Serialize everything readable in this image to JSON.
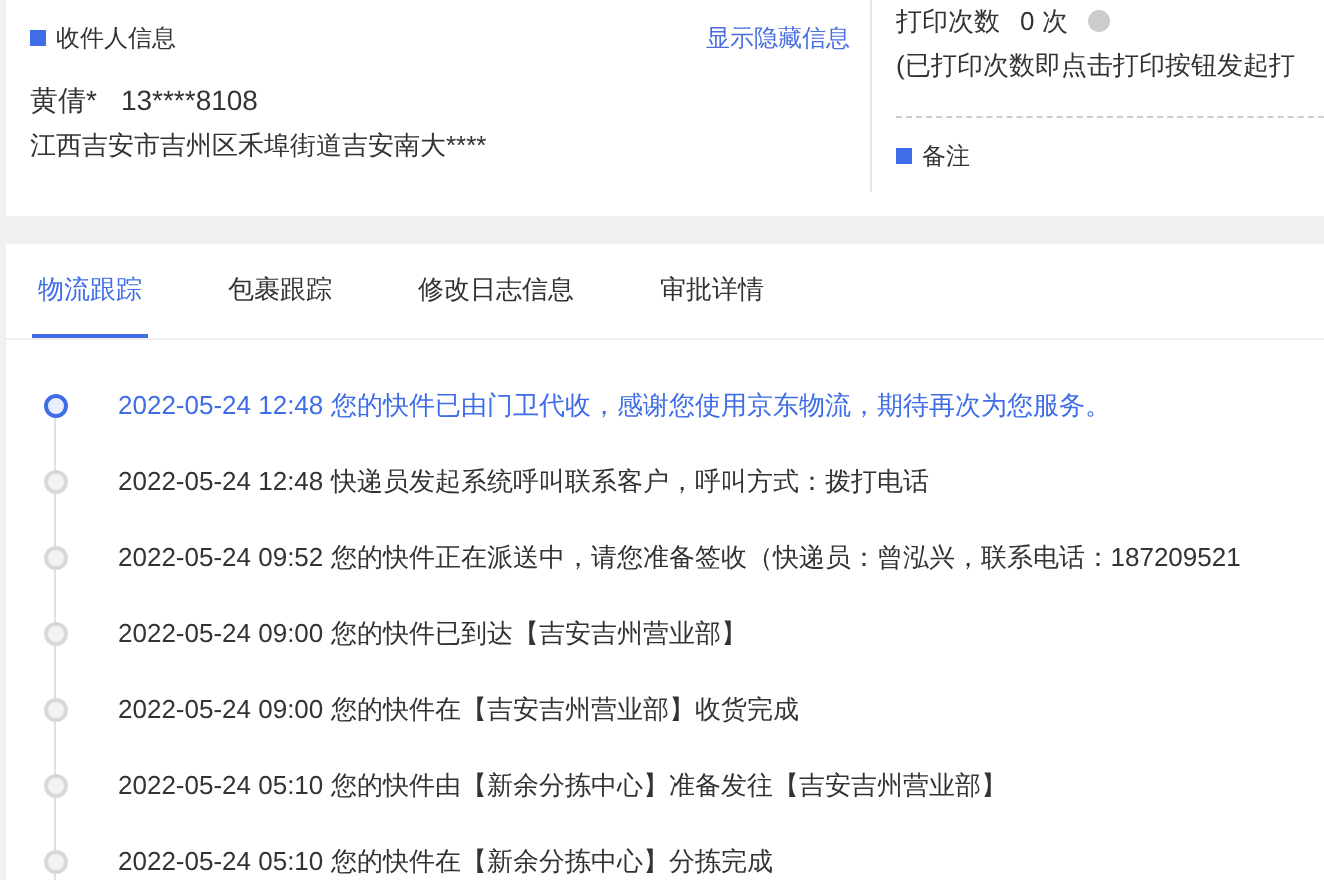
{
  "receiver": {
    "title": "收件人信息",
    "toggle_link": "显示隐藏信息",
    "name": "黄倩*",
    "phone": "13****8108",
    "address": "江西吉安市吉州区禾埠街道吉安南大****"
  },
  "print": {
    "label": "打印次数",
    "count": "0 次",
    "note": "(已打印次数即点击打印按钮发起打"
  },
  "remark": {
    "title": "备注"
  },
  "tabs": [
    {
      "label": "物流跟踪",
      "selected": true
    },
    {
      "label": "包裹跟踪",
      "selected": false
    },
    {
      "label": "修改日志信息",
      "selected": false
    },
    {
      "label": "审批详情",
      "selected": false
    }
  ],
  "timeline": [
    {
      "text": "2022-05-24 12:48 您的快件已由门卫代收，感谢您使用京东物流，期待再次为您服务。",
      "current": true
    },
    {
      "text": "2022-05-24 12:48 快递员发起系统呼叫联系客户，呼叫方式：拨打电话",
      "current": false
    },
    {
      "text": "2022-05-24 09:52 您的快件正在派送中，请您准备签收（快递员：曾泓兴，联系电话：187209521",
      "current": false
    },
    {
      "text": "2022-05-24 09:00 您的快件已到达【吉安吉州营业部】",
      "current": false
    },
    {
      "text": "2022-05-24 09:00 您的快件在【吉安吉州营业部】收货完成",
      "current": false
    },
    {
      "text": "2022-05-24 05:10 您的快件由【新余分拣中心】准备发往【吉安吉州营业部】",
      "current": false
    },
    {
      "text": "2022-05-24 05:10 您的快件在【新余分拣中心】分拣完成",
      "current": false
    }
  ]
}
